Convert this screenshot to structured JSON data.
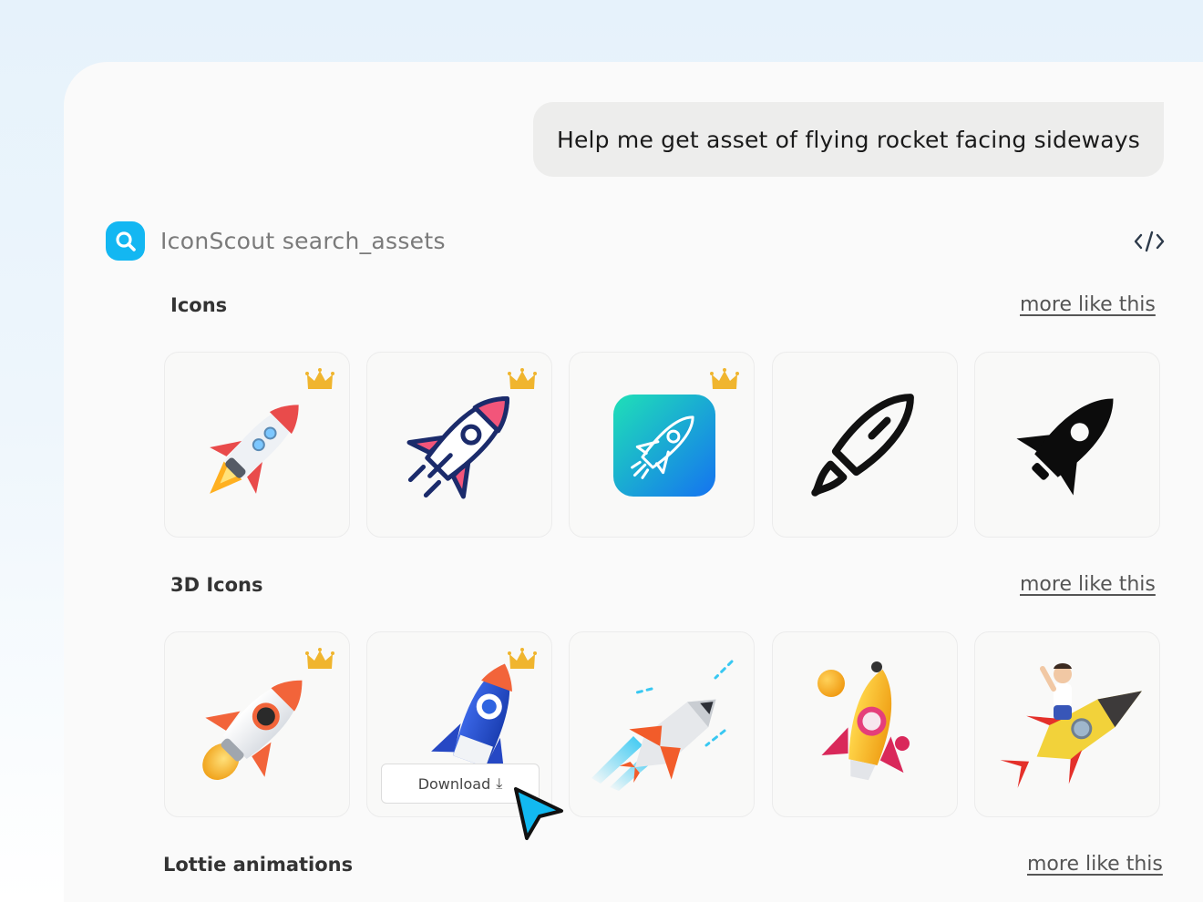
{
  "chat": {
    "user_message": "Help me get asset of flying rocket facing sideways"
  },
  "tool": {
    "name": "IconScout search_assets",
    "icon": "search-icon",
    "code_icon": "code-icon"
  },
  "sections": [
    {
      "title": "Icons",
      "more_label": "more like this",
      "items": [
        {
          "name": "rocket-color-icon",
          "premium": true
        },
        {
          "name": "rocket-lineal-color-icon",
          "premium": true
        },
        {
          "name": "rocket-app-tile-icon",
          "premium": true
        },
        {
          "name": "rocket-outline-icon",
          "premium": false
        },
        {
          "name": "rocket-solid-icon",
          "premium": false
        }
      ]
    },
    {
      "title": "3D Icons",
      "more_label": "more like this",
      "items": [
        {
          "name": "rocket-3d-orange",
          "premium": true
        },
        {
          "name": "rocket-3d-blue",
          "premium": true
        },
        {
          "name": "space-shuttle-3d",
          "premium": false
        },
        {
          "name": "rocket-3d-yellow-planets",
          "premium": false
        },
        {
          "name": "man-riding-rocket-3d",
          "premium": false
        }
      ]
    },
    {
      "title": "Lottie animations",
      "more_label": "more like this"
    }
  ],
  "download_button": {
    "label": "Download",
    "icon": "download-arrow-icon"
  },
  "colors": {
    "accent": "#13b7f2",
    "crown": "#f0b52e",
    "bubble": "#ededec"
  }
}
